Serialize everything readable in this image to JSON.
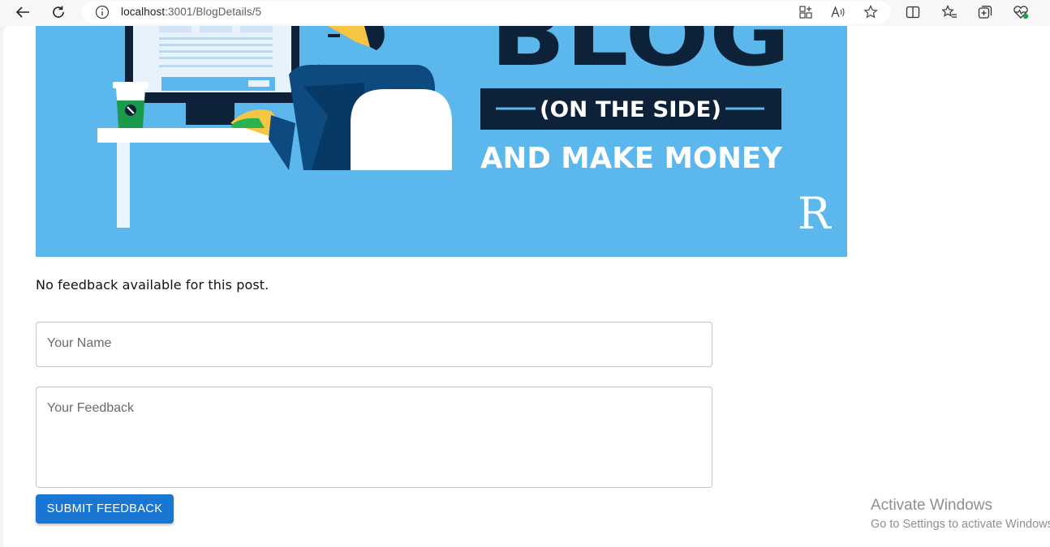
{
  "browser": {
    "url_host": "localhost",
    "url_rest": ":3001/BlogDetails/5",
    "icons": [
      "back-icon",
      "refresh-icon",
      "site-info-icon",
      "apps-icon",
      "read-aloud-icon",
      "favorite-star-icon",
      "split-screen-icon",
      "favorites-icon",
      "collections-icon",
      "browser-essentials-icon"
    ]
  },
  "hero": {
    "line_blog": "BLOG",
    "line_side": "(ON THE SIDE)",
    "line_money": "AND MAKE MONEY",
    "logo_letter": "R",
    "colors": {
      "background": "#5bb7ec",
      "navy": "#0d2238",
      "white": "#ffffff",
      "cup_green": "#1a9b4b",
      "skin": "#f6c544"
    }
  },
  "feedback": {
    "empty_message": "No feedback available for this post.",
    "name_placeholder": "Your Name",
    "feedback_placeholder": "Your Feedback",
    "submit_label": "SUBMIT FEEDBACK"
  },
  "os_watermark": {
    "title": "Activate Windows",
    "subtitle": "Go to Settings to activate Windows."
  },
  "colors": {
    "primary_button": "#1976d2"
  }
}
